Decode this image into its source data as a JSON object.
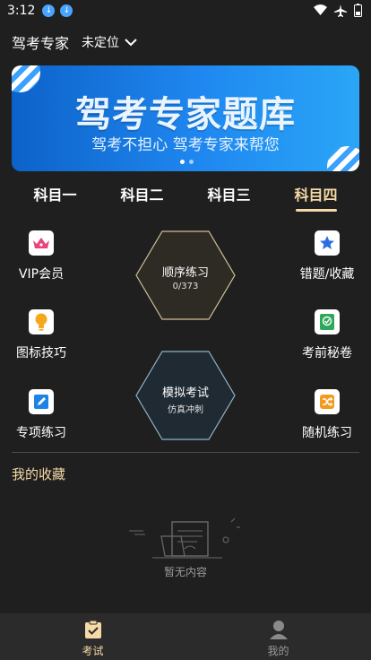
{
  "status_bar": {
    "time": "3:12"
  },
  "header": {
    "app_title": "驾考专家",
    "location": "未定位"
  },
  "banner": {
    "title": "驾考专家题库",
    "subtitle": "驾考不担心 驾考专家来帮您",
    "slide_count": 2,
    "active_slide": 1
  },
  "tabs": [
    {
      "label": "科目一",
      "active": false
    },
    {
      "label": "科目二",
      "active": false
    },
    {
      "label": "科目三",
      "active": false
    },
    {
      "label": "科目四",
      "active": true
    }
  ],
  "features": {
    "vip": {
      "label": "VIP会员",
      "icon": "crown-icon"
    },
    "wrong": {
      "label": "错题/收藏",
      "icon": "star-icon"
    },
    "signs": {
      "label": "图标技巧",
      "icon": "lightbulb-icon"
    },
    "secret": {
      "label": "考前秘卷",
      "icon": "book-icon"
    },
    "special": {
      "label": "专项练习",
      "icon": "edit-icon"
    },
    "random": {
      "label": "随机练习",
      "icon": "shuffle-icon"
    }
  },
  "sequence_practice": {
    "label": "顺序练习",
    "progress": "0/373"
  },
  "mock_exam": {
    "label": "模拟考试",
    "sub": "仿真冲刺"
  },
  "favorites": {
    "title": "我的收藏",
    "empty_text": "暂无内容"
  },
  "bottom_nav": [
    {
      "label": "考试",
      "icon": "clipboard-check-icon",
      "active": true
    },
    {
      "label": "我的",
      "icon": "person-icon",
      "active": false
    }
  ],
  "colors": {
    "background": "#1f1f1f",
    "accent": "#f5d9a6",
    "banner": "#1f88f0"
  }
}
